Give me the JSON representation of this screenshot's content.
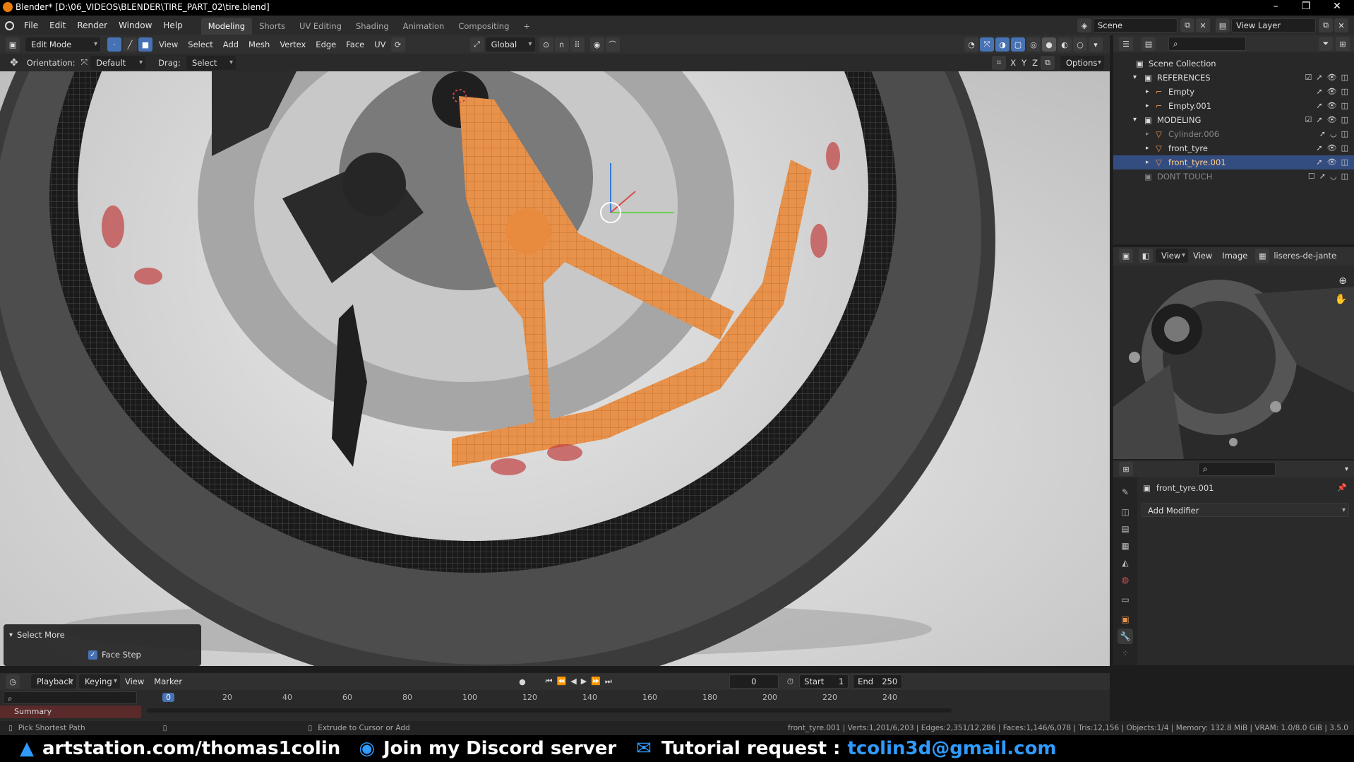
{
  "window": {
    "title": "Blender* [D:\\06_VIDEOS\\BLENDER\\TIRE_PART_02\\tire.blend]",
    "minimize": "–",
    "maximize": "❐",
    "close": "✕"
  },
  "menubar": {
    "items": [
      "File",
      "Edit",
      "Render",
      "Window",
      "Help"
    ],
    "workspaces": [
      "Modeling",
      "Shorts",
      "UV Editing",
      "Shading",
      "Animation",
      "Compositing"
    ],
    "add_workspace": "+",
    "scene": "Scene",
    "view_layer": "View Layer"
  },
  "viewport_header": {
    "mode": "Edit Mode",
    "menus": [
      "View",
      "Select",
      "Add",
      "Mesh",
      "Vertex",
      "Edge",
      "Face",
      "UV"
    ],
    "transform_orientation": "Global"
  },
  "tool_settings": {
    "orientation_label": "Orientation:",
    "orientation_value": "Default",
    "drag_label": "Drag:",
    "drag_value": "Select Box",
    "axes": [
      "X",
      "Y",
      "Z"
    ],
    "options": "Options"
  },
  "select_more": {
    "title": "Select More",
    "face_step": "Face Step",
    "face_step_checked": true
  },
  "outliner": {
    "root": "Scene Collection",
    "rows": [
      {
        "name": "REFERENCES",
        "level": 1
      },
      {
        "name": "Empty",
        "level": 2
      },
      {
        "name": "Empty.001",
        "level": 2
      },
      {
        "name": "MODELING",
        "level": 1
      },
      {
        "name": "Cylinder.006",
        "level": 2
      },
      {
        "name": "front_tyre",
        "level": 2
      },
      {
        "name": "front_tyre.001",
        "level": 2,
        "selected": true
      },
      {
        "name": "DONT TOUCH",
        "level": 1
      }
    ]
  },
  "image_editor": {
    "view": "View",
    "view2": "View",
    "image": "Image",
    "image_name": "liseres-de-jantes-h"
  },
  "properties": {
    "object_name": "front_tyre.001",
    "add_modifier": "Add Modifier"
  },
  "timeline": {
    "menus": [
      "Playback",
      "Keying",
      "View",
      "Marker"
    ],
    "current_frame": "0",
    "start_label": "Start",
    "start": "1",
    "end_label": "End",
    "end": "250",
    "ticks": [
      "0",
      "20",
      "40",
      "60",
      "80",
      "100",
      "120",
      "140",
      "160",
      "180",
      "200",
      "220",
      "240"
    ],
    "summary": "Summary"
  },
  "statusbar": {
    "left": "Pick Shortest Path",
    "middle": "Extrude to Cursor or Add",
    "stats": "front_tyre.001 | Verts:1,201/6,203 | Edges:2,351/12,286 | Faces:1,146/6,078 | Tris:12,156 | Objects:1/4 | Memory: 132.8 MiB | VRAM: 1.0/8.0 GiB | 3.5.0"
  },
  "banner": {
    "artstation": "artstation.com/thomas1colin",
    "discord": "Join my Discord server",
    "tutorial": "Tutorial request :",
    "email": "tcolin3d@gmail.com",
    "email_color": "#2f9bff"
  }
}
